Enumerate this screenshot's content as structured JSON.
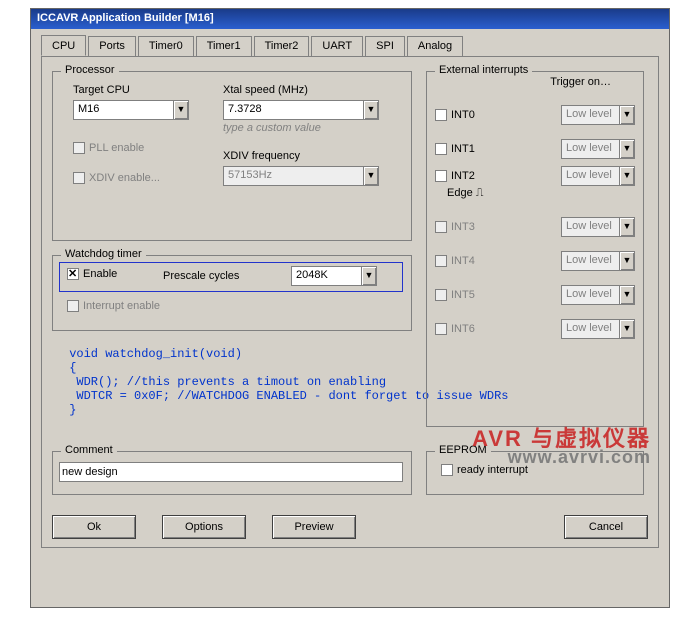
{
  "window": {
    "title": "ICCAVR Application Builder [M16]"
  },
  "tabs": [
    "CPU",
    "Ports",
    "Timer0",
    "Timer1",
    "Timer2",
    "UART",
    "SPI",
    "Analog"
  ],
  "processor": {
    "title": "Processor",
    "target_label": "Target CPU",
    "target_value": "M16",
    "xtal_label": "Xtal speed (MHz)",
    "xtal_value": "7.3728",
    "xtal_hint": "type a custom value",
    "pll_label": "PLL enable",
    "xdiv_label": "XDIV enable...",
    "xdivfreq_label": "XDIV frequency",
    "xdivfreq_value": "57153Hz"
  },
  "watchdog": {
    "title": "Watchdog timer",
    "enable_label": "Enable",
    "prescale_label": "Prescale cycles",
    "prescale_value": "2048K",
    "interrupt_label": "Interrupt enable"
  },
  "code": " void watchdog_init(void)\n {\n  WDR(); //this prevents a timout on enabling\n  WDTCR = 0x0F; //WATCHDOG ENABLED - dont forget to issue WDRs\n }",
  "comment": {
    "title": "Comment",
    "value": "new design"
  },
  "extint": {
    "title": "External interrupts",
    "trigger_label": "Trigger on…",
    "rows": [
      {
        "name": "INT0",
        "value": "Low level",
        "enabled": true
      },
      {
        "name": "INT1",
        "value": "Low level",
        "enabled": true
      },
      {
        "name": "INT2",
        "value": "Low level",
        "enabled": true,
        "edge": "Edge"
      },
      {
        "name": "INT3",
        "value": "Low level",
        "enabled": false
      },
      {
        "name": "INT4",
        "value": "Low level",
        "enabled": false
      },
      {
        "name": "INT5",
        "value": "Low level",
        "enabled": false
      },
      {
        "name": "INT6",
        "value": "Low level",
        "enabled": false
      }
    ]
  },
  "eeprom": {
    "title": "EEPROM",
    "ready_label": "ready interrupt"
  },
  "buttons": {
    "ok": "Ok",
    "options": "Options",
    "preview": "Preview",
    "cancel": "Cancel"
  },
  "watermark": {
    "line1": "AVR 与虚拟仪器",
    "line2": "www.avrvi.com"
  }
}
